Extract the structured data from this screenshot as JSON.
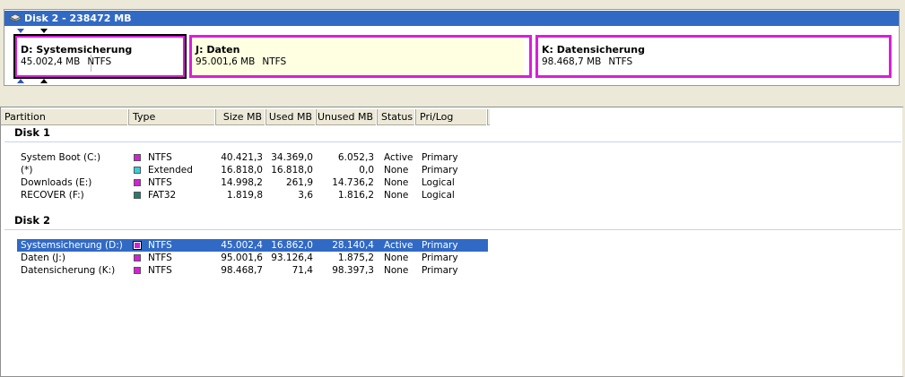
{
  "disk_map": {
    "title": "Disk 2 - 238472 MB",
    "partitions": [
      {
        "name": "D:  Systemsicherung",
        "size": "45.002,4 MB",
        "fs": "NTFS",
        "selected": true
      },
      {
        "name": "J:  Daten",
        "size": "95.001,6 MB",
        "fs": "NTFS",
        "selected": false
      },
      {
        "name": "K:  Datensicherung",
        "size": "98.468,7 MB",
        "fs": "NTFS",
        "selected": false
      }
    ]
  },
  "columns": {
    "partition": "Partition",
    "type": "Type",
    "size": "Size MB",
    "used": "Used MB",
    "unused": "Unused MB",
    "status": "Status",
    "prilog": "Pri/Log"
  },
  "groups": [
    {
      "title": "Disk 1",
      "rows": [
        {
          "partition": "System Boot (C:)",
          "type": "NTFS",
          "color": "#d81fd8",
          "size": "40.421,3",
          "used": "34.369,0",
          "unused": "6.052,3",
          "status": "Active",
          "prilog": "Primary"
        },
        {
          "partition": "(*)",
          "type": "Extended",
          "color": "#33d0e0",
          "size": "16.818,0",
          "used": "16.818,0",
          "unused": "0,0",
          "status": "None",
          "prilog": "Primary"
        },
        {
          "partition": "Downloads (E:)",
          "type": "NTFS",
          "color": "#d81fd8",
          "size": "14.998,2",
          "used": "261,9",
          "unused": "14.736,2",
          "status": "None",
          "prilog": "Logical"
        },
        {
          "partition": "RECOVER (F:)",
          "type": "FAT32",
          "color": "#1f7f6f",
          "size": "1.819,8",
          "used": "3,6",
          "unused": "1.816,2",
          "status": "None",
          "prilog": "Logical"
        }
      ]
    },
    {
      "title": "Disk 2",
      "rows": [
        {
          "partition": "Systemsicherung (D:)",
          "type": "NTFS",
          "color": "#d81fd8",
          "size": "45.002,4",
          "used": "16.862,0",
          "unused": "28.140,4",
          "status": "Active",
          "prilog": "Primary",
          "selected": true
        },
        {
          "partition": "Daten (J:)",
          "type": "NTFS",
          "color": "#d81fd8",
          "size": "95.001,6",
          "used": "93.126,4",
          "unused": "1.875,2",
          "status": "None",
          "prilog": "Primary"
        },
        {
          "partition": "Datensicherung (K:)",
          "type": "NTFS",
          "color": "#d81fd8",
          "size": "98.468,7",
          "used": "71,4",
          "unused": "98.397,3",
          "status": "None",
          "prilog": "Primary"
        }
      ]
    }
  ]
}
